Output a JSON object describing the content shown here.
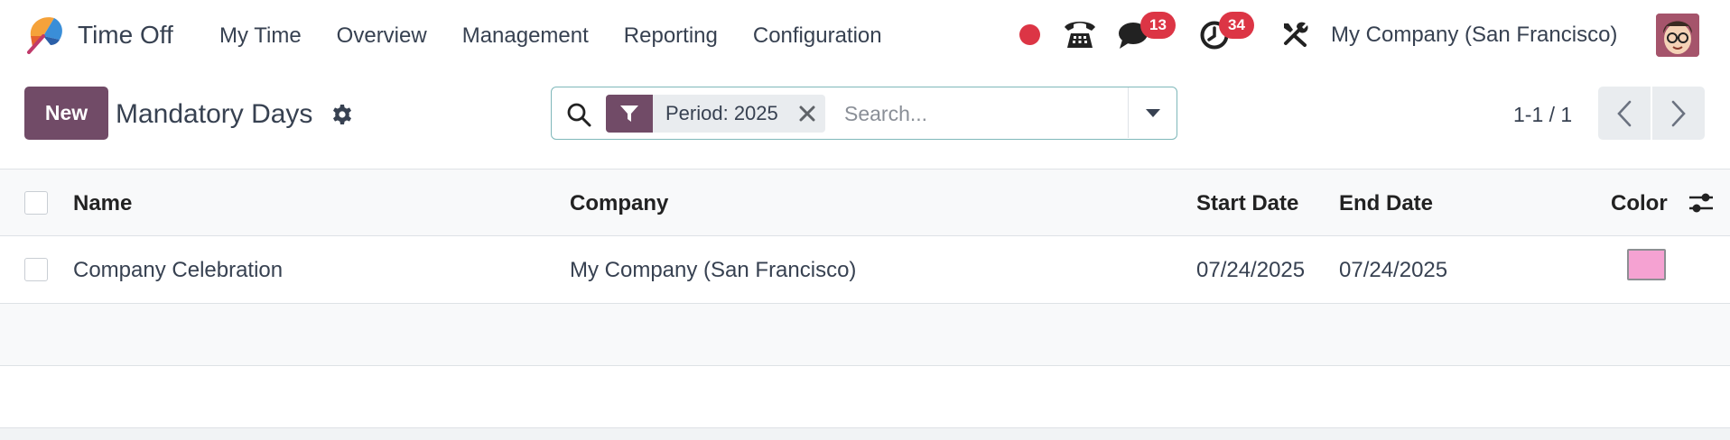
{
  "navbar": {
    "app_name": "Time Off",
    "menu": [
      "My Time",
      "Overview",
      "Management",
      "Reporting",
      "Configuration"
    ],
    "badges": {
      "messages": "13",
      "activities": "34"
    },
    "company": "My Company (San Francisco)"
  },
  "control_panel": {
    "new_label": "New",
    "title": "Mandatory Days",
    "search": {
      "facet_label": "Period: 2025",
      "placeholder": "Search..."
    },
    "pager": "1-1 / 1"
  },
  "list": {
    "columns": [
      "Name",
      "Company",
      "Start Date",
      "End Date",
      "Color"
    ],
    "rows": [
      {
        "name": "Company Celebration",
        "company": "My Company (San Francisco)",
        "start_date": "07/24/2025",
        "end_date": "07/24/2025",
        "color": "#f5a2d2"
      }
    ]
  },
  "colors": {
    "brand": "#714b67",
    "badge": "#dc3545",
    "focus_border": "#7fb8ba"
  },
  "icons": [
    "app-logo-icon",
    "record-dot-icon",
    "phone-icon",
    "chat-icon",
    "activity-clock-icon",
    "tools-icon",
    "settings-gear-icon",
    "search-icon",
    "filter-icon",
    "close-icon",
    "caret-down-icon",
    "chevron-left-icon",
    "chevron-right-icon",
    "optional-columns-icon"
  ]
}
